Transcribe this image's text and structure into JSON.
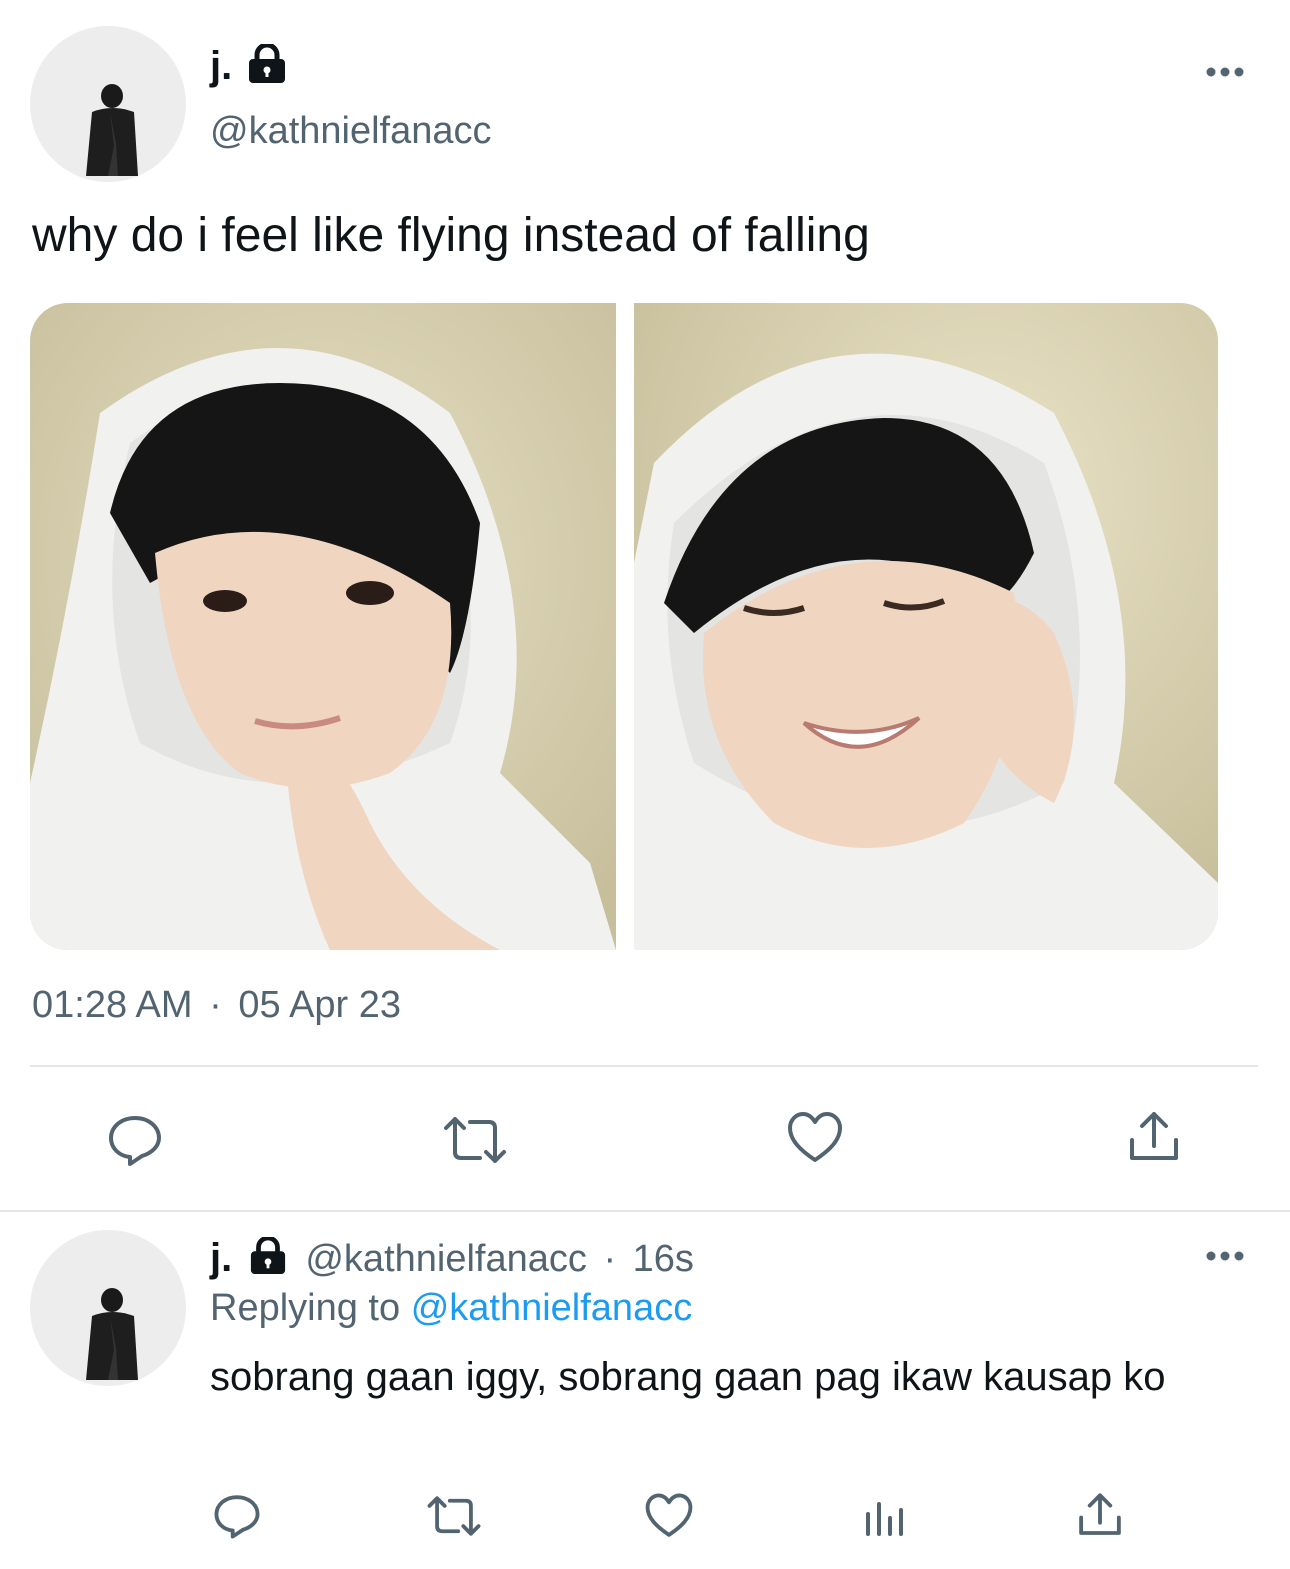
{
  "main_tweet": {
    "display_name": "j.",
    "handle": "@kathnielfanacc",
    "text": "why do i feel like flying instead of falling",
    "time": "01:28 AM",
    "separator": "·",
    "date": "05 Apr 23",
    "photos": [
      "photo-1",
      "photo-2"
    ]
  },
  "reply_tweet": {
    "display_name": "j.",
    "handle": "@kathnielfanacc",
    "separator": "·",
    "age": "16s",
    "replying_prefix": "Replying to",
    "replying_to": "@kathnielfanacc",
    "text": "sobrang gaan iggy, sobrang gaan pag ikaw kausap ko"
  },
  "icons": {
    "lock": "lock-icon",
    "more": "more-icon",
    "reply": "reply-icon",
    "retweet": "retweet-icon",
    "like": "like-icon",
    "analytics": "analytics-icon",
    "share": "share-icon"
  },
  "colors": {
    "text": "#0f1419",
    "secondary": "#536471",
    "link": "#1d9bf0",
    "divider": "#e4e7ea",
    "icon": "#536471"
  }
}
